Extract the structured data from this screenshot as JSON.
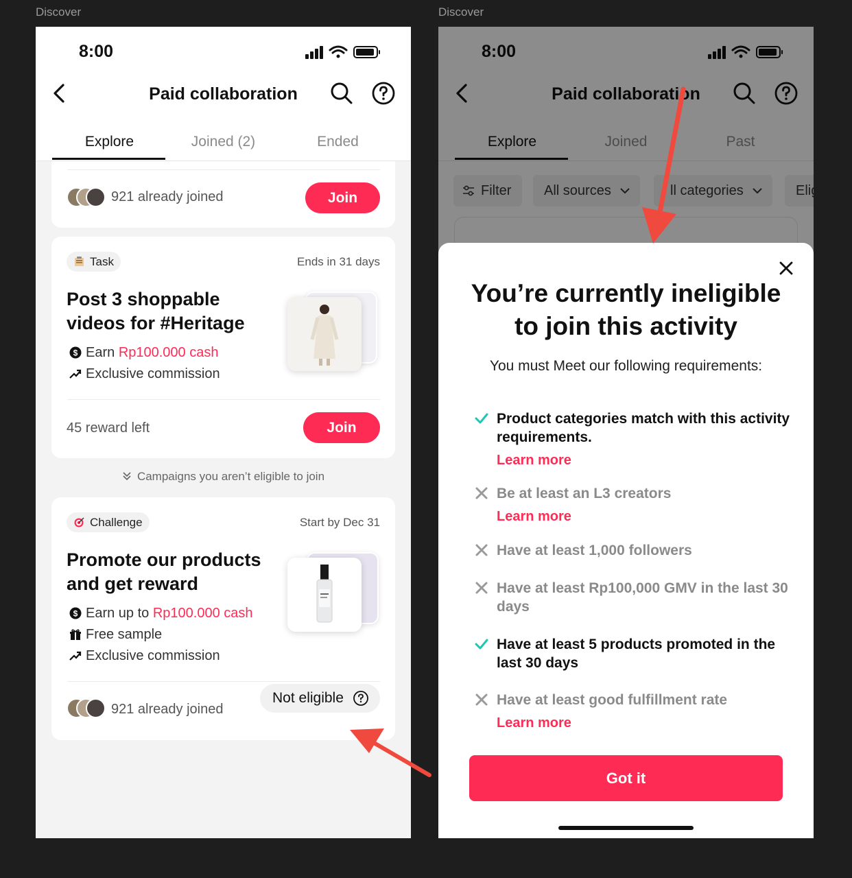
{
  "frames": [
    {
      "label": "Discover"
    },
    {
      "label": "Discover"
    }
  ],
  "left": {
    "status": {
      "time": "8:00"
    },
    "nav": {
      "title": "Paid collaboration"
    },
    "tabs": [
      {
        "label": "Explore"
      },
      {
        "label": "Joined (2)"
      },
      {
        "label": "Ended"
      }
    ],
    "card1": {
      "joined": "921 already joined",
      "button": "Join"
    },
    "card2": {
      "tag": "Task",
      "meta": "Ends in 31 days",
      "title": "Post 3 shoppable videos for #Heritage",
      "perk1_prefix": "Earn ",
      "perk1_value": "Rp100.000 cash",
      "perk2": "Exclusive commission",
      "reward_left": "45 reward left",
      "button": "Join"
    },
    "section_note": "Campaigns you aren’t eligible to join",
    "card3": {
      "tag": "Challenge",
      "meta": "Start by Dec 31",
      "title": "Promote our products and get reward",
      "perk1_prefix": "Earn up to ",
      "perk1_value": "Rp100.000 cash",
      "perk2": "Free sample",
      "perk3": "Exclusive commission",
      "joined": "921 already joined",
      "button": "Not eligible"
    }
  },
  "right": {
    "status": {
      "time": "8:00"
    },
    "nav": {
      "title": "Paid collaboration"
    },
    "tabs": [
      {
        "label": "Explore"
      },
      {
        "label": "Joined"
      },
      {
        "label": "Past"
      }
    ],
    "filters": [
      {
        "label": "Filter"
      },
      {
        "label": "All sources"
      },
      {
        "label": "ll categories"
      },
      {
        "label": "Elig"
      }
    ],
    "sheet": {
      "title": "You’re currently ineligible to join this activity",
      "subtitle": "You must Meet our following requirements:",
      "requirements": [
        {
          "text": "Product categories match with this activity requirements.",
          "met": true,
          "link": "Learn more"
        },
        {
          "text": "Be at least an L3 creators",
          "met": false,
          "link": "Learn more"
        },
        {
          "text": "Have at least 1,000 followers",
          "met": false
        },
        {
          "text": "Have at least Rp100,000 GMV in the last 30 days",
          "met": false
        },
        {
          "text": "Have at least 5 products promoted in the last 30 days",
          "met": true
        },
        {
          "text": "Have at least good fulfillment rate",
          "met": false,
          "link": "Learn more"
        }
      ],
      "button": "Got it"
    }
  },
  "colors": {
    "accent": "#fe2c55",
    "check": "#20c5b4",
    "cross": "#9a9a9a"
  }
}
